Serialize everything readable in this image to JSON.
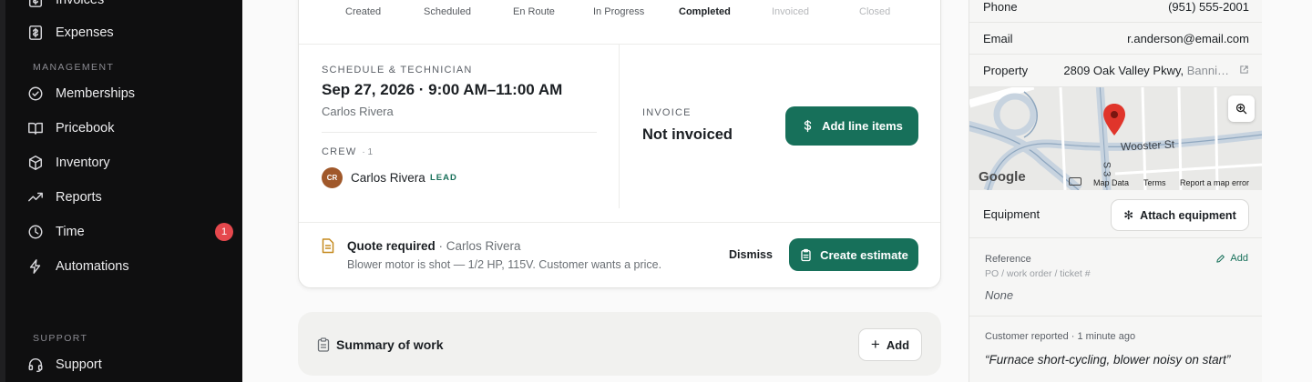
{
  "sidebar": {
    "items_top": [
      {
        "label": "Invoices",
        "icon": "invoice-icon"
      },
      {
        "label": "Expenses",
        "icon": "expense-icon"
      }
    ],
    "management_label": "MANAGEMENT",
    "items_management": [
      {
        "label": "Memberships",
        "icon": "check-circle-icon"
      },
      {
        "label": "Pricebook",
        "icon": "book-icon"
      },
      {
        "label": "Inventory",
        "icon": "box-icon"
      },
      {
        "label": "Reports",
        "icon": "trend-icon"
      },
      {
        "label": "Time",
        "icon": "clock-icon",
        "badge": "1"
      },
      {
        "label": "Automations",
        "icon": "bolt-icon"
      }
    ],
    "support_label": "SUPPORT",
    "items_support": [
      {
        "label": "Support",
        "icon": "headset-icon"
      }
    ]
  },
  "job": {
    "steps": [
      {
        "label": "Created",
        "state": "done"
      },
      {
        "label": "Scheduled",
        "state": "done"
      },
      {
        "label": "En Route",
        "state": "done"
      },
      {
        "label": "In Progress",
        "state": "done"
      },
      {
        "label": "Completed",
        "state": "active"
      },
      {
        "label": "Invoiced",
        "state": "future"
      },
      {
        "label": "Closed",
        "state": "future"
      }
    ],
    "schedule_label": "SCHEDULE & TECHNICIAN",
    "schedule_date": "Sep 27, 2026 · 9:00 AM–11:00 AM",
    "technician": "Carlos Rivera",
    "crew_label": "CREW",
    "crew_count": "· 1",
    "crew": [
      {
        "initials": "CR",
        "name": "Carlos Rivera",
        "tag": "LEAD"
      }
    ],
    "invoice_label": "INVOICE",
    "invoice_status": "Not invoiced",
    "add_line_items_label": "Add line items",
    "quote_title": "Quote required",
    "quote_by": " · Carlos Rivera",
    "quote_desc": "Blower motor is shot — 1/2 HP, 115V. Customer wants a price.",
    "dismiss_label": "Dismiss",
    "create_estimate_label": "Create estimate",
    "summary_title": "Summary of work",
    "summary_add_label": "Add"
  },
  "customer": {
    "phone_label": "Phone",
    "phone": "(951) 555-2001",
    "email_label": "Email",
    "email": "r.anderson@email.com",
    "property_label": "Property",
    "property_main": "2809 Oak Valley Pkwy,",
    "property_rest": " Banni…",
    "map": {
      "street_label": "Wooster St",
      "cross_street": "S 3",
      "google_label": "Google",
      "map_data_label": "Map Data",
      "terms_label": "Terms",
      "report_label": "Report a map error"
    },
    "equipment_label": "Equipment",
    "attach_equipment_label": "Attach equipment",
    "reference_label": "Reference",
    "reference_sub": "PO / work order / ticket #",
    "reference_add": "Add",
    "reference_value": "None",
    "reported_meta": "Customer reported · 1 minute ago",
    "reported_quote": "“Furnace short-cycling, blower noisy on start”"
  },
  "colors": {
    "accent": "#17705a",
    "sidebar_bg": "#0f0f10",
    "badge": "#e5484d",
    "map_pin": "#e0352b"
  }
}
